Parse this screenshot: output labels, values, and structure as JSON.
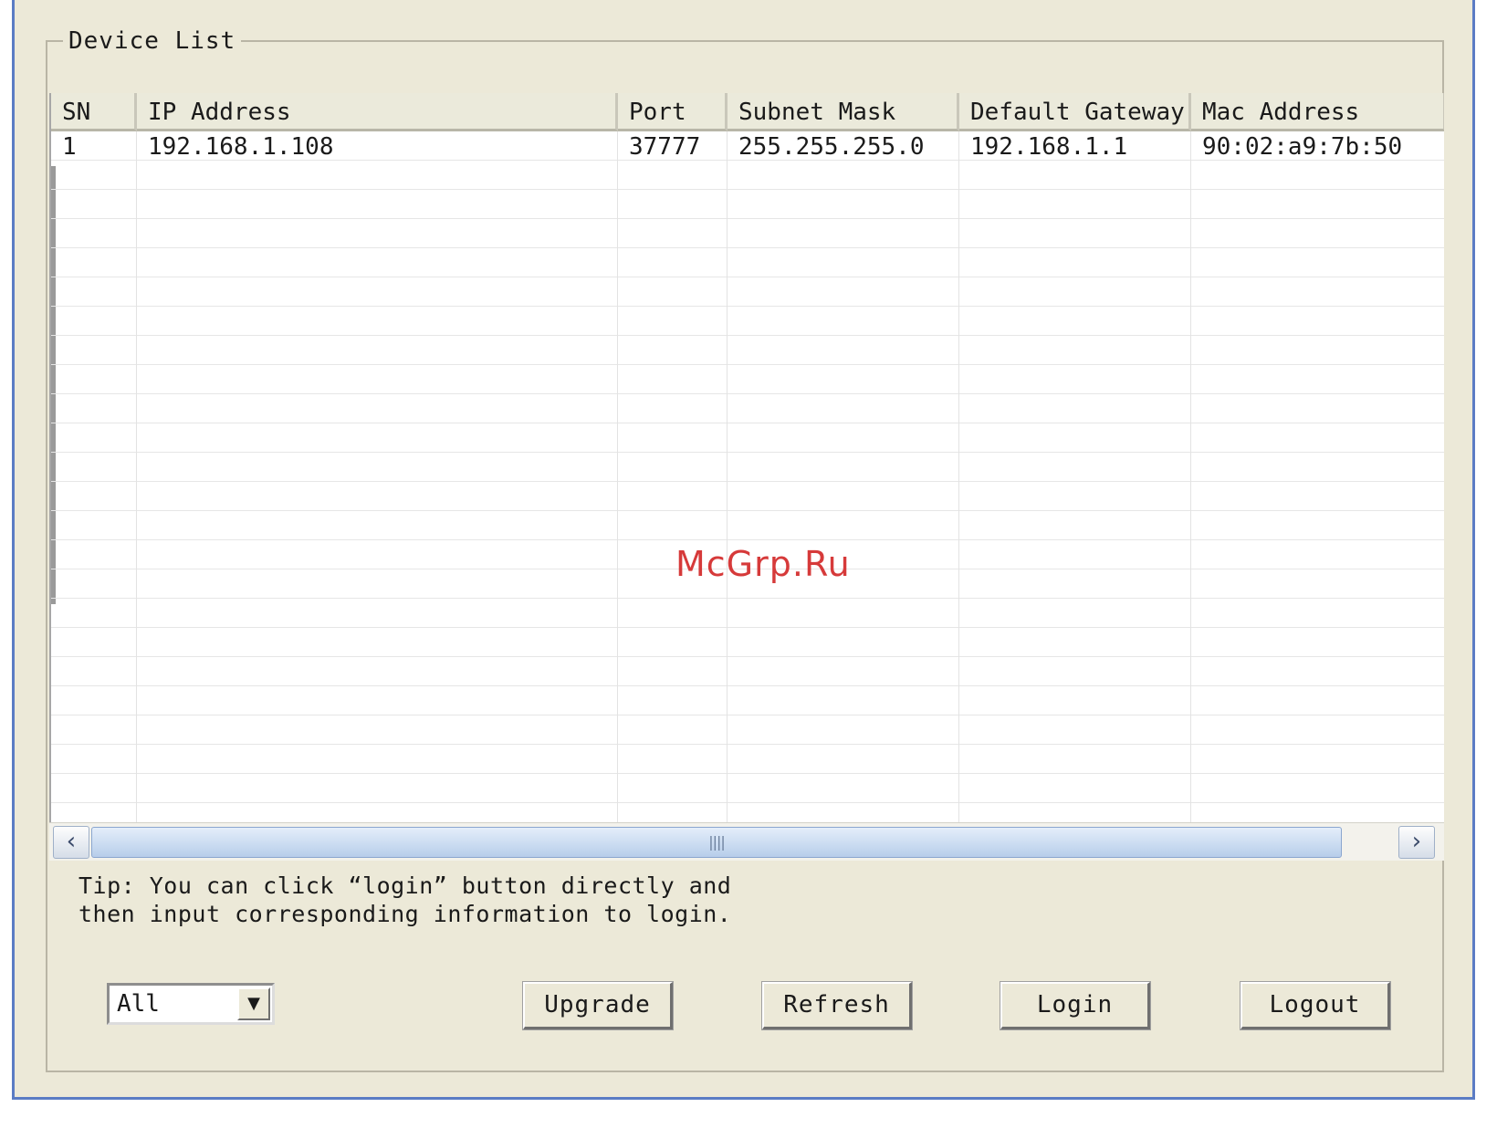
{
  "group": {
    "title": "Device List"
  },
  "table": {
    "columns": [
      "SN",
      "IP Address",
      "Port",
      "Subnet Mask",
      "Default Gateway",
      "Mac Address"
    ],
    "rows": [
      [
        "1",
        "192.168.1.108",
        "37777",
        "255.255.255.0",
        "192.168.1.1",
        "90:02:a9:7b:50"
      ]
    ]
  },
  "scrollbar": {
    "left_icon": "chevron-left-icon",
    "right_icon": "chevron-right-icon",
    "grip": "||||"
  },
  "tip": {
    "line1": "Tip: You can click “login” button directly and",
    "line2": "then input corresponding information to login."
  },
  "filter": {
    "selected": "All"
  },
  "buttons": {
    "upgrade": "Upgrade",
    "refresh": "Refresh",
    "login": "Login",
    "logout": "Logout"
  },
  "watermark": "McGrp.Ru",
  "colors": {
    "window_bg": "#ece9d8",
    "frame": "#5b7cc4",
    "watermark": "#d63a3a"
  }
}
